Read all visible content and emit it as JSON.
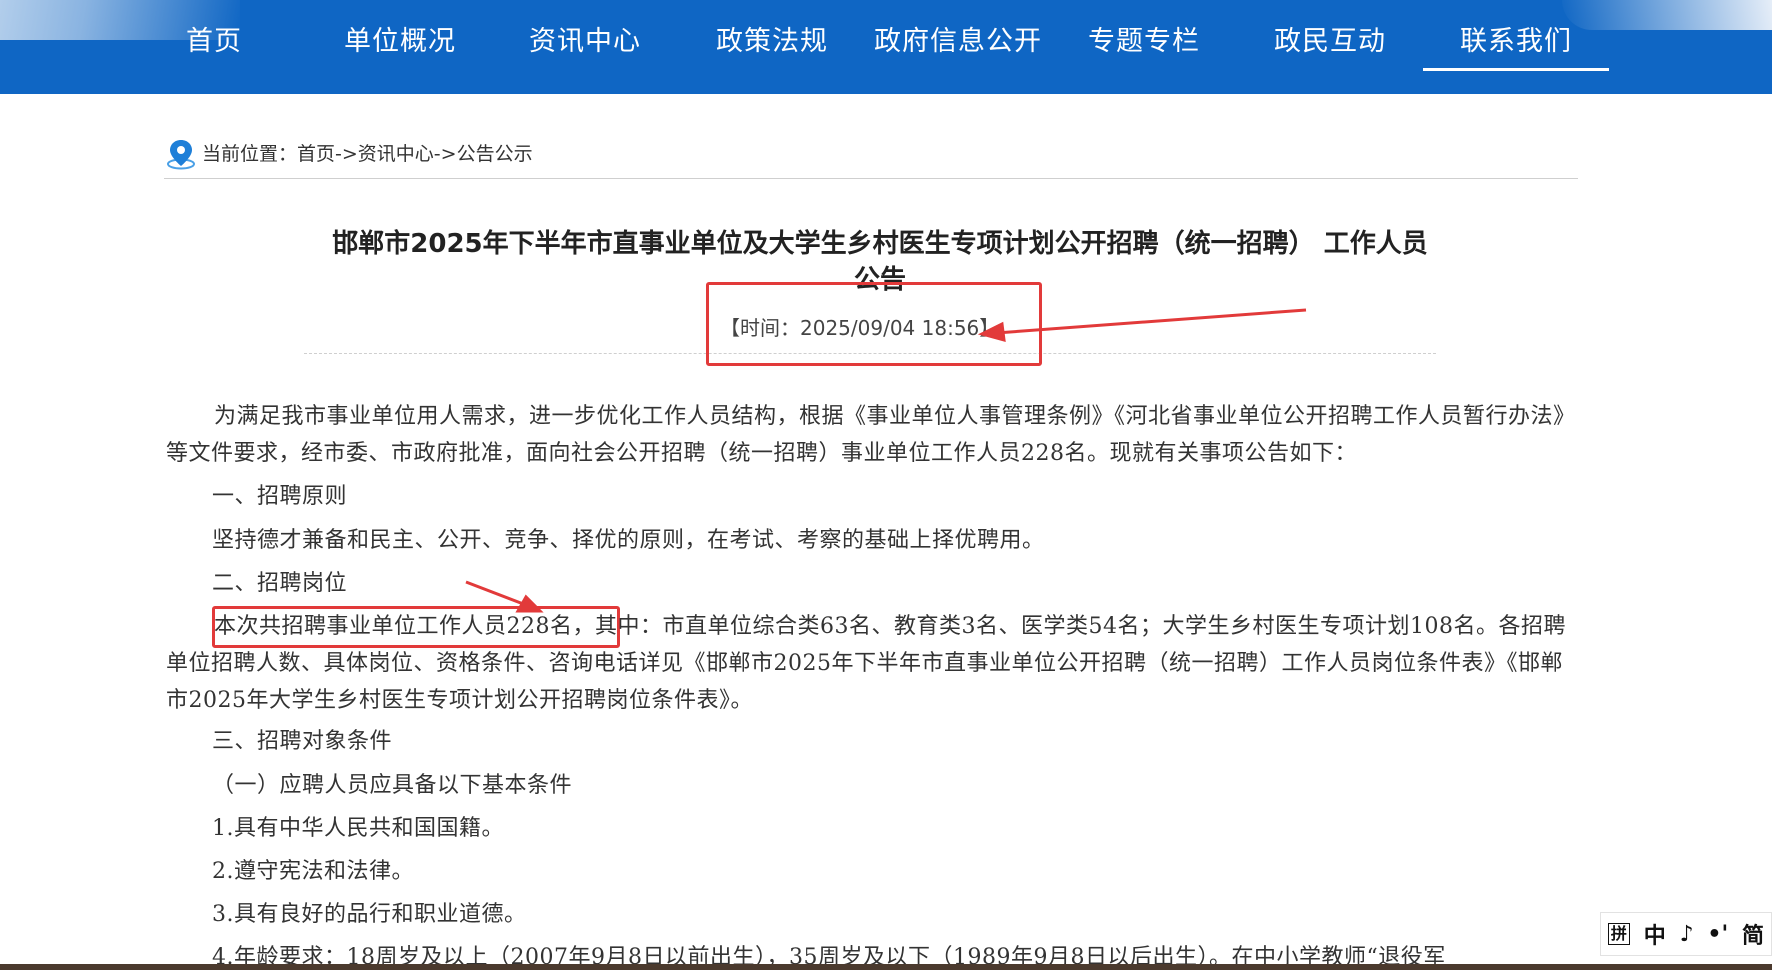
{
  "nav": {
    "items": [
      "首页",
      "单位概况",
      "资讯中心",
      "政策法规",
      "政府信息公开",
      "专题专栏",
      "政民互动",
      "联系我们"
    ],
    "active_index": 7,
    "color": "#0f66c4"
  },
  "breadcrumb": {
    "label": "当前位置：",
    "path": "首页->资讯中心->公告公示",
    "icon": "location-pin-icon"
  },
  "article": {
    "title_line1": "邯郸市2025年下半年市直事业单位及大学生乡村医生专项计划公开招聘（统一招聘） 工作人员",
    "title_line2": "公告",
    "time": "【时间：2025/09/04 18:56】",
    "paragraphs": [
      "为满足我市事业单位用人需求，进一步优化工作人员结构，根据《事业单位人事管理条例》《河北省事业单位公开招聘工作人员暂行办法》等文件要求，经市委、市政府批准，面向社会公开招聘（统一招聘）事业单位工作人员228名。现就有关事项公告如下：",
      "一、招聘原则",
      "坚持德才兼备和民主、公开、竞争、择优的原则，在考试、考察的基础上择优聘用。",
      "二、招聘岗位",
      "本次共招聘事业单位工作人员228名，其中：市直单位综合类63名、教育类3名、医学类54名；大学生乡村医生专项计划108名。各招聘单位招聘人数、具体岗位、资格条件、咨询电话详见《邯郸市2025年下半年市直事业单位公开招聘（统一招聘）工作人员岗位条件表》《邯郸市2025年大学生乡村医生专项计划公开招聘岗位条件表》。",
      "三、招聘对象条件",
      "（一）应聘人员应具备以下基本条件",
      "1.具有中华人民共和国国籍。",
      "2.遵守宪法和法律。",
      "3.具有良好的品行和职业道德。",
      "4.年龄要求：18周岁及以上（2007年9月8日以前出生），35周岁及以下（1989年9月8日以后出生）。在中小学教师“退役军"
    ]
  },
  "annotation": {
    "color": "#e23a3a"
  },
  "ime": {
    "box": "拼",
    "lang": "中",
    "mode1": "♪",
    "mode2": "•ꞌ",
    "script": "简"
  }
}
